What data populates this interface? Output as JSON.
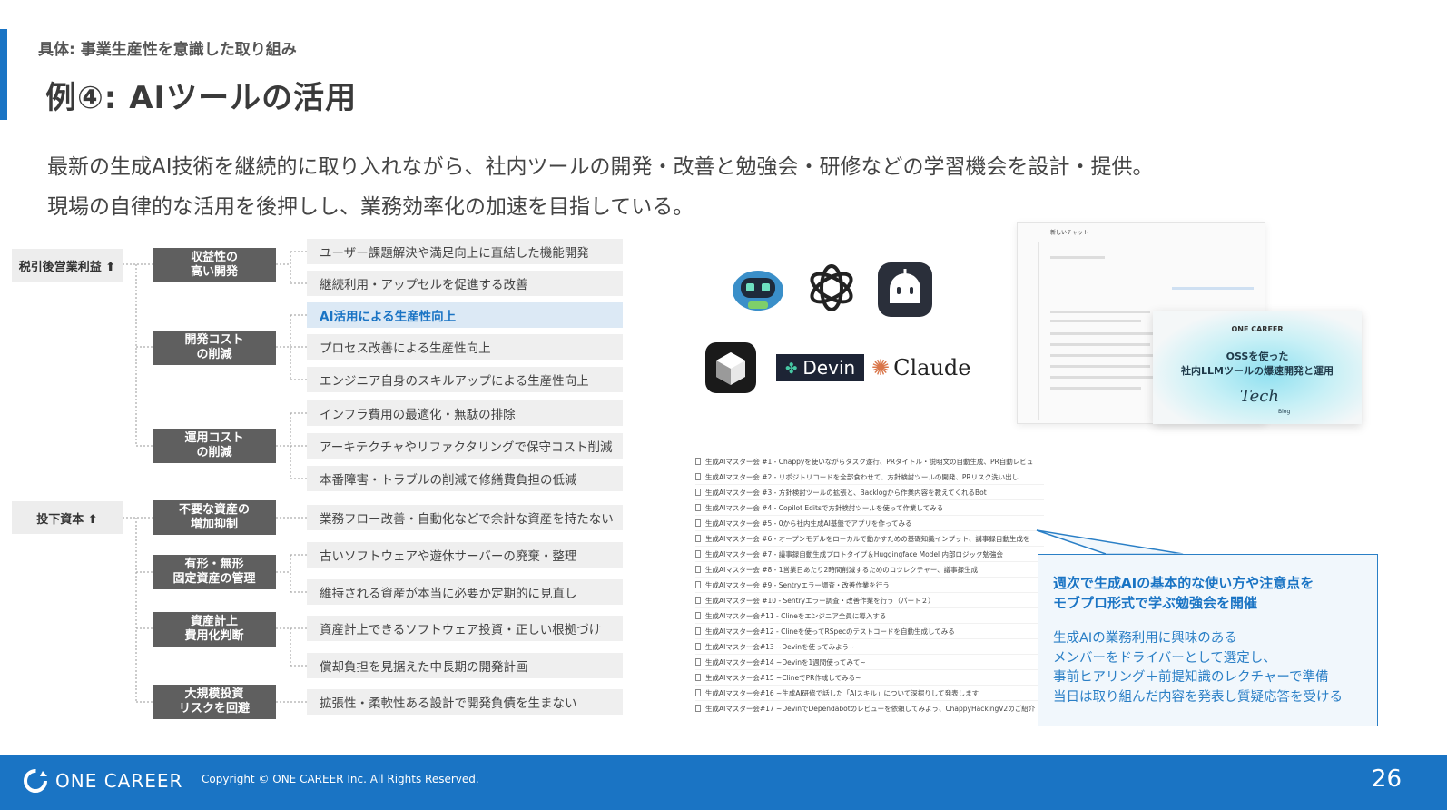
{
  "header": {
    "subtitle": "具体: 事業生産性を意識した取り組み",
    "title": "例④: AIツールの活用",
    "desc1": "最新の生成AI技術を継続的に取り入れながら、社内ツールの開発・改善と勉強会・研修などの学習機会を設計・提供。",
    "desc2": "現場の自律的な活用を後押しし、業務効率化の加速を目指している。"
  },
  "tree": {
    "roots": [
      "税引後営業利益 ⬆",
      "投下資本 ⬆"
    ],
    "mids": [
      "収益性の\n高い開発",
      "開発コスト\nの削減",
      "運用コスト\nの削減",
      "不要な資産の\n増加抑制",
      "有形・無形\n固定資産の管理",
      "資産計上\n費用化判断",
      "大規模投資\nリスクを回避"
    ],
    "leaves": [
      "ユーザー課題解決や満足向上に直結した機能開発",
      "継続利用・アップセルを促進する改善",
      "AI活用による生産性向上",
      "プロセス改善による生産性向上",
      "エンジニア自身のスキルアップによる生産性向上",
      "インフラ費用の最適化・無駄の排除",
      "アーキテクチャやリファクタリングで保守コスト削減",
      "本番障害・トラブルの削減で修繕費負担の低減",
      "業務フロー改善・自動化などで余計な資産を持たない",
      "古いソフトウェアや遊休サーバーの廃棄・整理",
      "維持される資産が本当に必要か定期的に見直し",
      "資産計上できるソフトウェア投資・正しい根拠づけ",
      "償却負担を見据えた中長期の開発計画",
      "拡張性・柔軟性ある設計で開発負債を生まない"
    ],
    "highlight_index": 2
  },
  "logos": {
    "devin": "Devin",
    "claude": "Claude"
  },
  "screenshot": {
    "title": "新しいチャット",
    "blog_brand": "ONE CAREER",
    "blog_t1": "OSSを使った",
    "blog_t2": "社内LLMツールの爆速開発と運用",
    "blog_tech": "Tech",
    "blog_sub": "Blog"
  },
  "doc_list": [
    "生成AIマスター会 #1 - Chappyを使いながらタスク遂行、PRタイトル・説明文の自動生成、PR自動レビュ",
    "生成AIマスター会 #2 - リポジトリコードを全部食わせて、方針検討ツールの開発、PRリスク洗い出し",
    "生成AIマスター会 #3 - 方針検討ツールの拡張と、Backlogから作業内容を教えてくれるBot",
    "生成AIマスター会 #4 - Copilot Editsで方針検討ツールを使って作業してみる",
    "生成AIマスター会 #5 - 0から社内生成AI基盤でアプリを作ってみる",
    "生成AIマスター会 #6 - オープンモデルをローカルで動かすための基礎知識インプット、講事録自動生成を",
    "生成AIマスター会 #7 - 議事録自動生成プロトタイプ＆Huggingface Model 内部ロジック勉強会",
    "生成AIマスター会 #8 - 1営業日あたり2時間削減するためのコツレクチャー、議事録生成",
    "生成AIマスター会 #9 - Sentryエラー調査・改善作業を行う",
    "生成AIマスター会 #10 - Sentryエラー調査・改善作業を行う（パート２）",
    "生成AIマスター会#11 - Clineをエンジニア全員に導入する",
    "生成AIマスター会#12 - Clineを使ってRSpecのテストコードを自動生成してみる",
    "生成AIマスター会#13 ~Devinを使ってみよう~",
    "生成AIマスター会#14 ~Devinを1週間使ってみて~",
    "生成AIマスター会#15 ~ClineでPR作成してみる~",
    "生成AIマスター会#16 ~生成AI研修で話した「AIスキル」について深掘りして発表します",
    "生成AIマスター会#17 ~DevinでDependabotのレビューを依頼してみよう、ChappyHackingV2のご紹介"
  ],
  "callout": {
    "heading": "週次で生成AIの基本的な使い方や注意点を\nモブプロ形式で学ぶ勉強会を開催",
    "body": "生成AIの業務利用に興味のある\nメンバーをドライバーとして選定し、\n事前ヒアリング＋前提知識のレクチャーで準備\n当日は取り組んだ内容を発表し質疑応答を受ける"
  },
  "footer": {
    "brand": "ONE CAREER",
    "copyright": "Copyright © ONE CAREER Inc. All Rights Reserved.",
    "page": "26"
  },
  "colors": {
    "accent": "#1a74c4",
    "mid_box": "#5f5f5f",
    "leaf_bg": "#efefef",
    "highlight_bg": "#dce9f5"
  }
}
